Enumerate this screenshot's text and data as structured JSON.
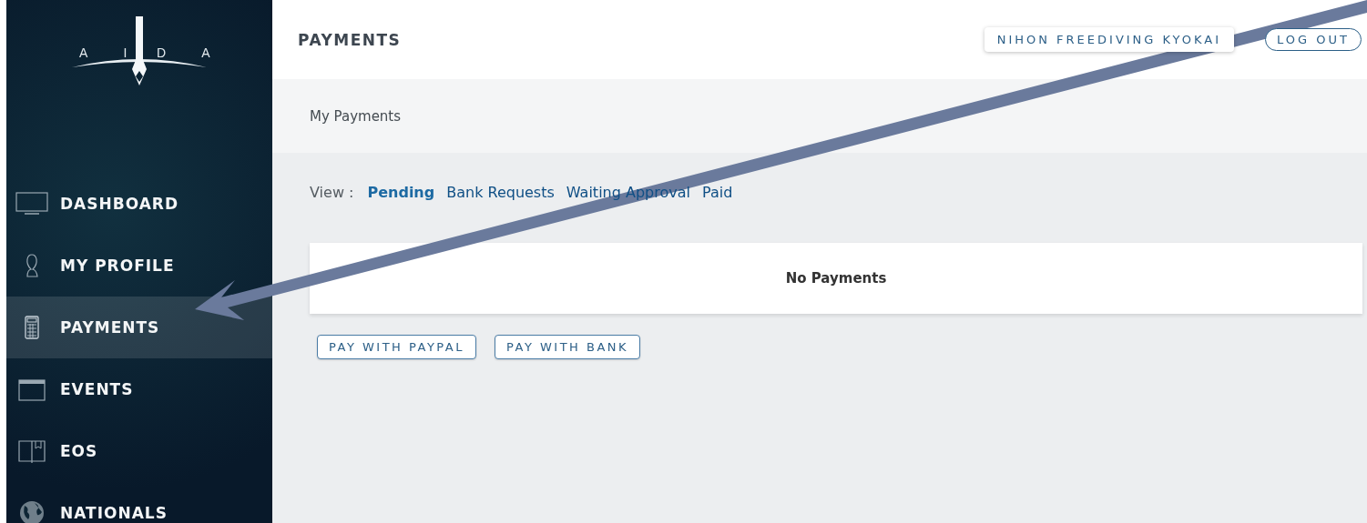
{
  "logo": {
    "left": "A I",
    "right": "D A"
  },
  "sidebar": {
    "items": [
      {
        "label": "DASHBOARD",
        "selected": false
      },
      {
        "label": "MY PROFILE",
        "selected": false
      },
      {
        "label": "PAYMENTS",
        "selected": true
      },
      {
        "label": "EVENTS",
        "selected": false
      },
      {
        "label": "EOS",
        "selected": false
      },
      {
        "label": "NATIONALS",
        "selected": false
      }
    ]
  },
  "header": {
    "title": "PAYMENTS",
    "organization": "NIHON FREEDIVING KYOKAI",
    "logout": "LOG OUT"
  },
  "breadcrumb": "My Payments",
  "view": {
    "label": "View :",
    "filters": [
      {
        "label": "Pending",
        "selected": true
      },
      {
        "label": "Bank Requests",
        "selected": false
      },
      {
        "label": "Waiting Approval",
        "selected": false
      },
      {
        "label": "Paid",
        "selected": false
      }
    ]
  },
  "empty_message": "No Payments",
  "buttons": [
    "PAY WITH PAYPAL",
    "PAY WITH BANK"
  ],
  "annotation": {
    "kind": "arrow"
  }
}
